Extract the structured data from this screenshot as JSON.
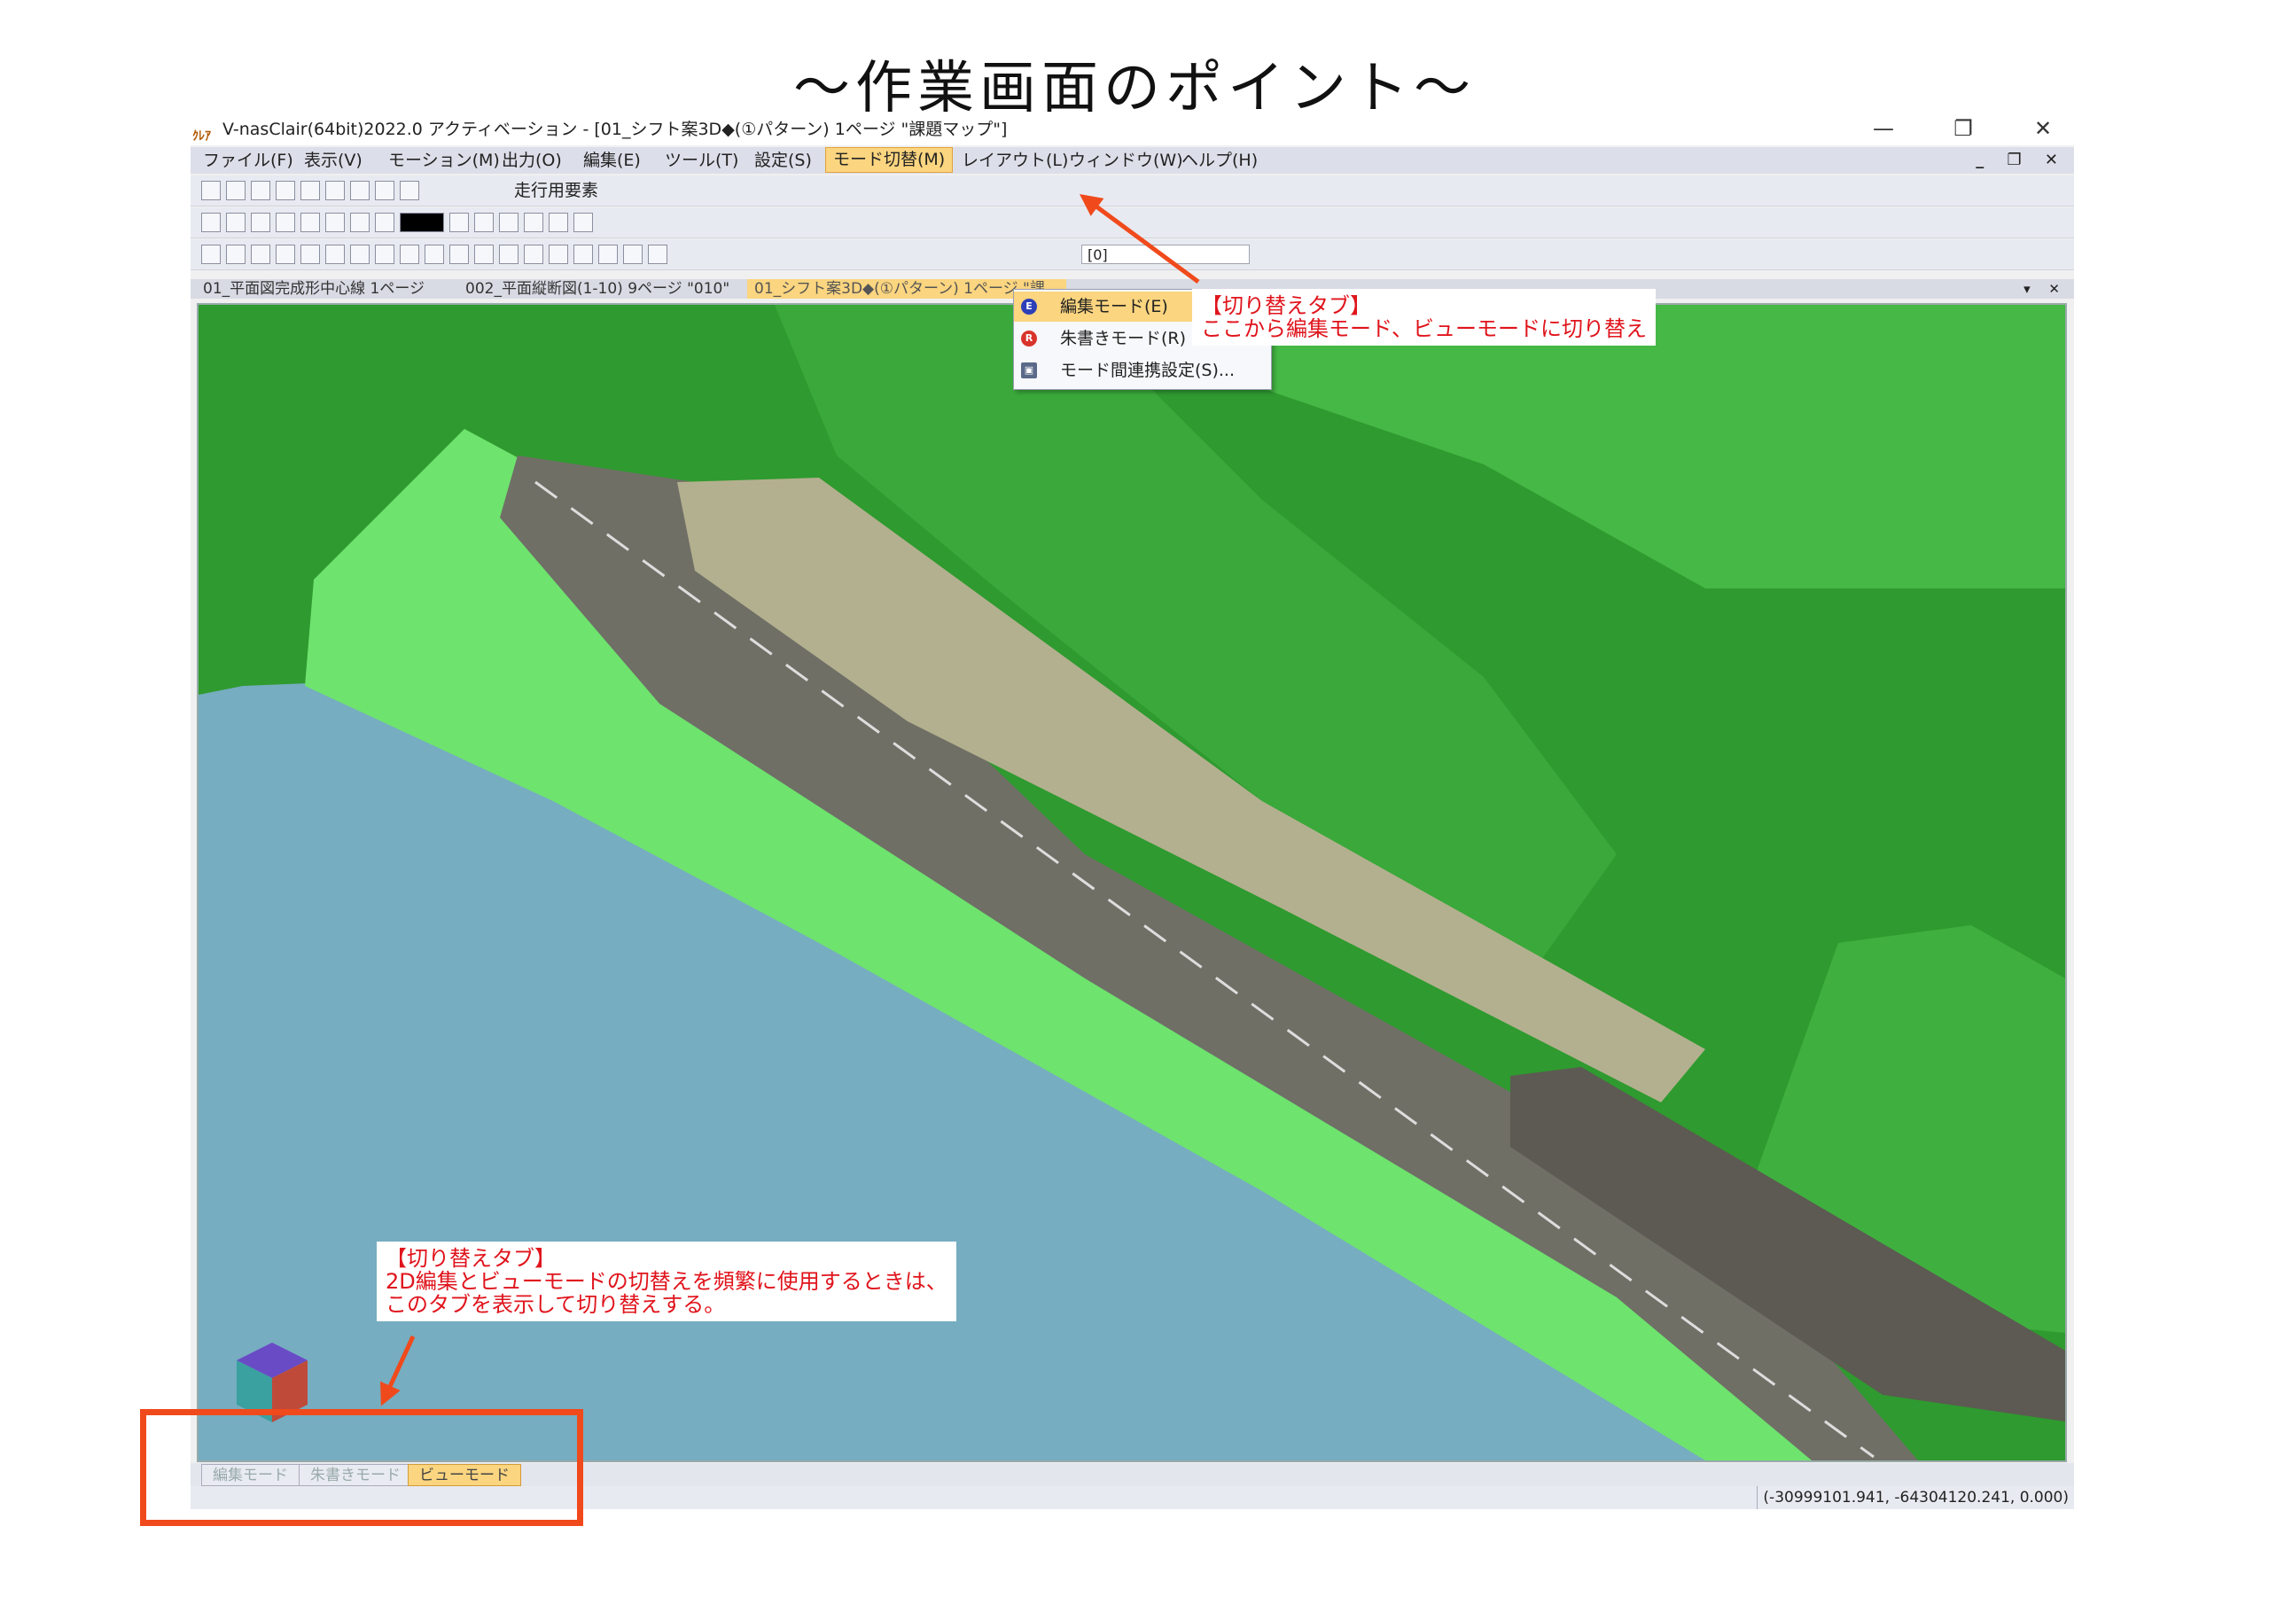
{
  "page_title": "～作業画面のポイント～",
  "window": {
    "app_icon": "ｸﾚｱ",
    "title": "V-nasClair(64bit)2022.0 アクティベーション - [01_シフト案3D◆(①パターン) 1ページ \"課題マップ\"]",
    "controls": {
      "minimize": "—",
      "restore": "❐",
      "close": "✕"
    }
  },
  "menubar": {
    "items": [
      "ファイル(F)",
      "表示(V)",
      "モーション(M)",
      "出力(O)",
      "編集(E)",
      "ツール(T)",
      "設定(S)",
      "モード切替(M)",
      "レイアウト(L)",
      "ウィンドウ(W)",
      "ヘルプ(H)"
    ],
    "active_index": 7,
    "mdi_controls": "_ ❐ ✕"
  },
  "toolbar": {
    "label": "走行用要素",
    "combo_value": "[0]"
  },
  "dropdown": {
    "items": [
      {
        "label": "編集モード(E)",
        "icon": "edit-mode-icon",
        "color": "#2d3fb8",
        "glyph": "E"
      },
      {
        "label": "朱書きモード(R)",
        "icon": "redline-mode-icon",
        "color": "#d9342b",
        "glyph": "R"
      },
      {
        "label": "モード間連携設定(S)...",
        "icon": "settings-icon",
        "color": "#5a6a88",
        "glyph": "▣"
      }
    ],
    "highlight_index": 0
  },
  "doc_tabs": {
    "items": [
      "01_平面図完成形中心線 1ページ",
      "002_平面縦断図(1-10) 9ページ \"010\"",
      "01_シフト案3D◆(①パターン) 1ページ \"課..."
    ],
    "active_index": 2,
    "controls": "▾ ✕"
  },
  "callouts": {
    "top": {
      "line1": "【切り替えタブ】",
      "line2": "ここから編集モード、ビューモードに切り替え"
    },
    "bottom": {
      "line1": "【切り替えタブ】",
      "line2": "2D編集とビューモードの切替えを頻繁に使用するときは、",
      "line3": "このタブを表示して切り替えする。"
    }
  },
  "bottom_tabs": {
    "items": [
      "編集モード",
      "朱書きモード",
      "ビューモード"
    ],
    "active_index": 2
  },
  "status": {
    "coord": "(-30999101.941, -64304120.241, 0.000)"
  },
  "colors": {
    "accent_orange": "#fbd57f",
    "callout_red": "#e0141c",
    "arrow_red": "#f04a1c",
    "terrain_dark": "#2f9a2f",
    "terrain_light": "#6ee36e",
    "water": "#76adc1",
    "road": "#808080"
  }
}
